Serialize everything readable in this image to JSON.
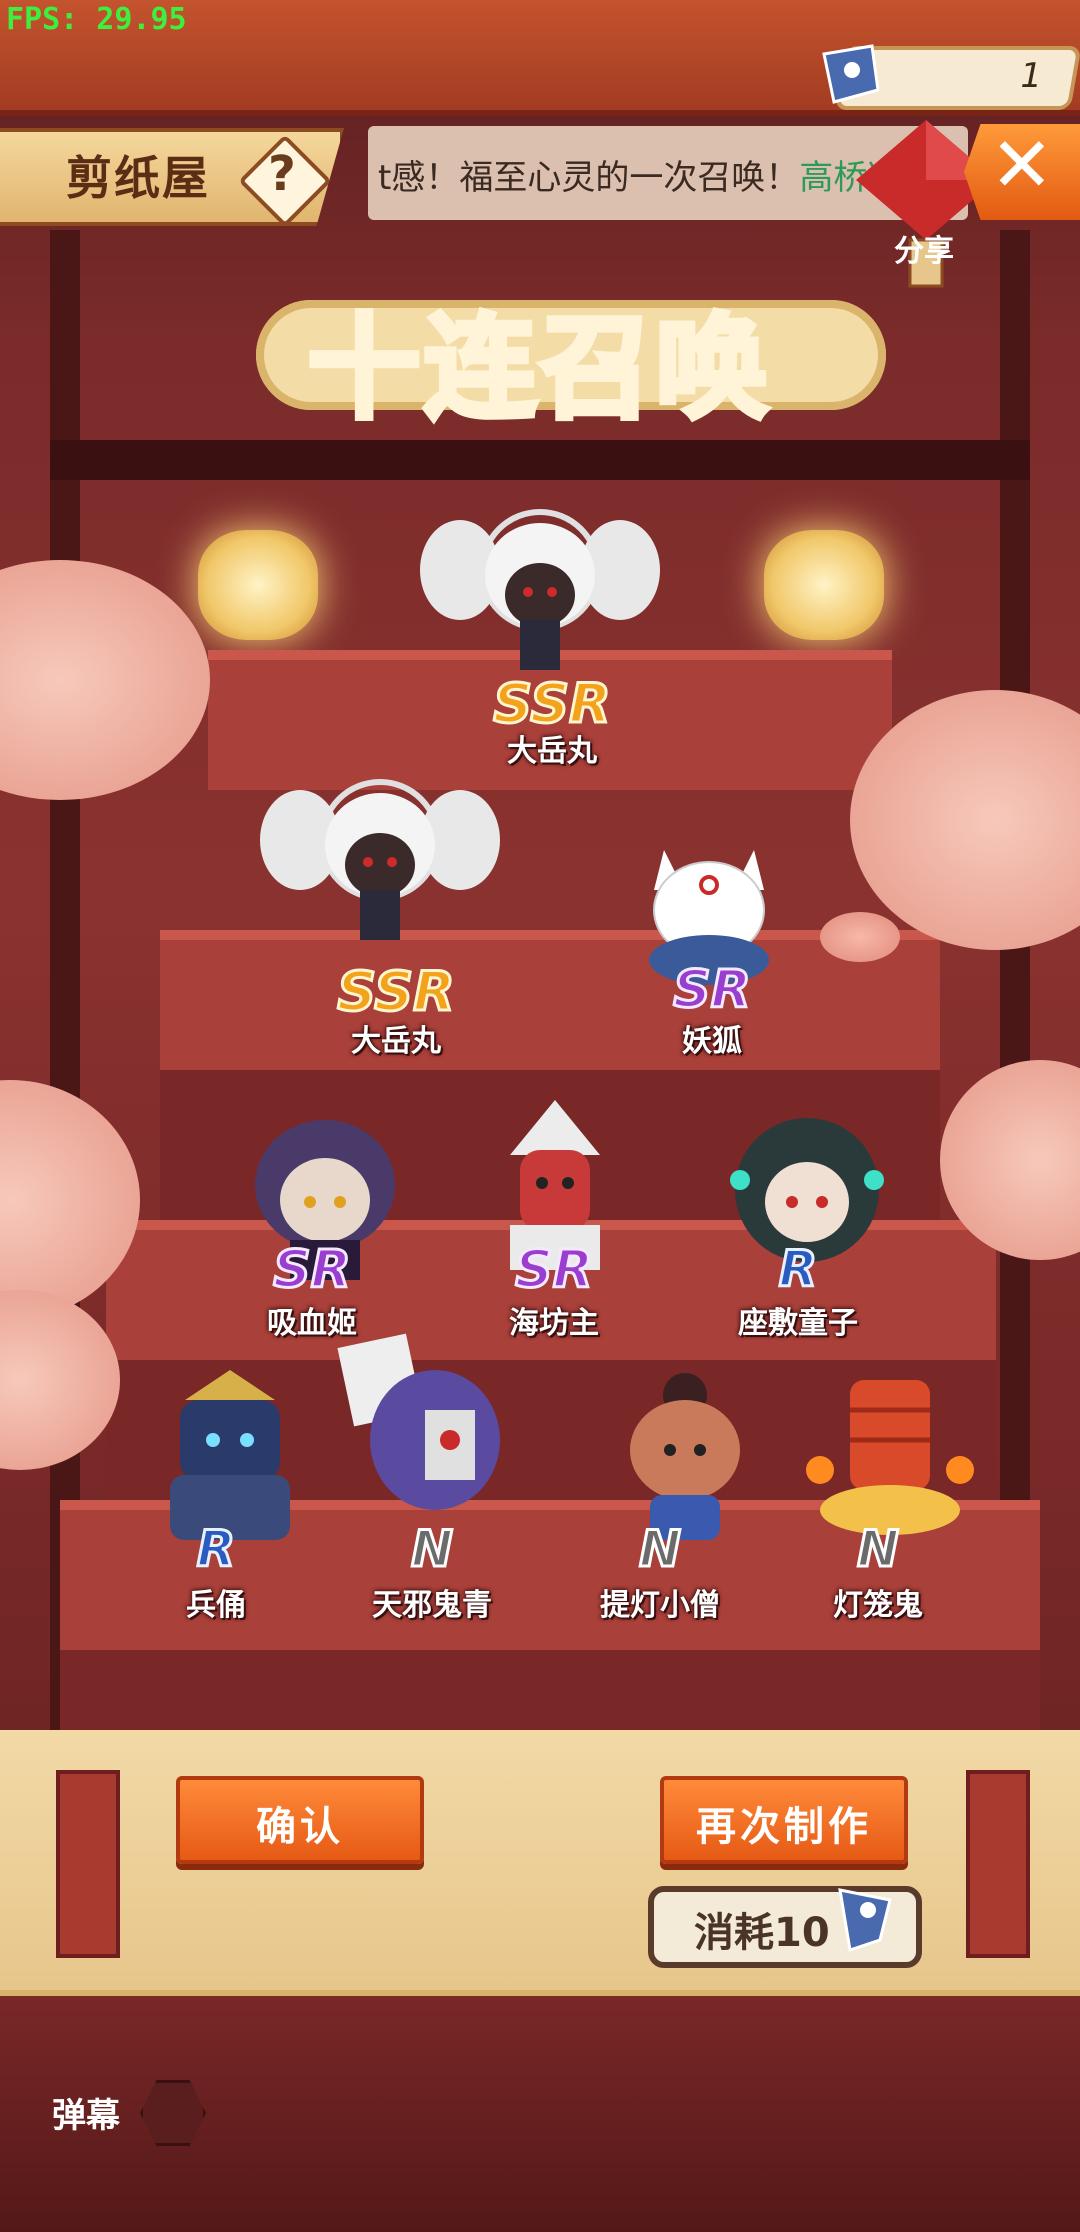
{
  "fps": "FPS: 29.95",
  "currency": {
    "value": "1",
    "icon": "paper-doll-icon"
  },
  "header": {
    "shop_title": "剪纸屋",
    "help_label": "?",
    "ticker_text": "t感！福至心灵的一次召唤！",
    "ticker_name": "高桥凉",
    "close_label": "✕",
    "share_label": "分享"
  },
  "title": "十连召唤",
  "characters": [
    {
      "name": "大岳丸",
      "rarity": "SSR",
      "color": "#f4f4f4",
      "accent": "#c92a2a"
    },
    {
      "name": "大岳丸",
      "rarity": "SSR",
      "color": "#f4f4f4",
      "accent": "#c92a2a"
    },
    {
      "name": "妖狐",
      "rarity": "SR",
      "color": "#ffffff",
      "accent": "#3a5a9a"
    },
    {
      "name": "吸血姬",
      "rarity": "SR",
      "color": "#4a3a6a",
      "accent": "#d8c4b8"
    },
    {
      "name": "海坊主",
      "rarity": "SR",
      "color": "#c83a3a",
      "accent": "#eaeaea"
    },
    {
      "name": "座敷童子",
      "rarity": "R",
      "color": "#2a3a3a",
      "accent": "#e8d2c4"
    },
    {
      "name": "兵俑",
      "rarity": "R",
      "color": "#2a3a6a",
      "accent": "#d8b04a"
    },
    {
      "name": "天邪鬼青",
      "rarity": "N",
      "color": "#5a4aa0",
      "accent": "#e0e0e0"
    },
    {
      "name": "提灯小僧",
      "rarity": "N",
      "color": "#c87a5a",
      "accent": "#3a5ab0"
    },
    {
      "name": "灯笼鬼",
      "rarity": "N",
      "color": "#d84a2a",
      "accent": "#f3c04a"
    }
  ],
  "buttons": {
    "confirm": "确认",
    "again": "再次制作",
    "cost": "消耗10"
  },
  "bottom": {
    "danmaku": "弹幕"
  }
}
